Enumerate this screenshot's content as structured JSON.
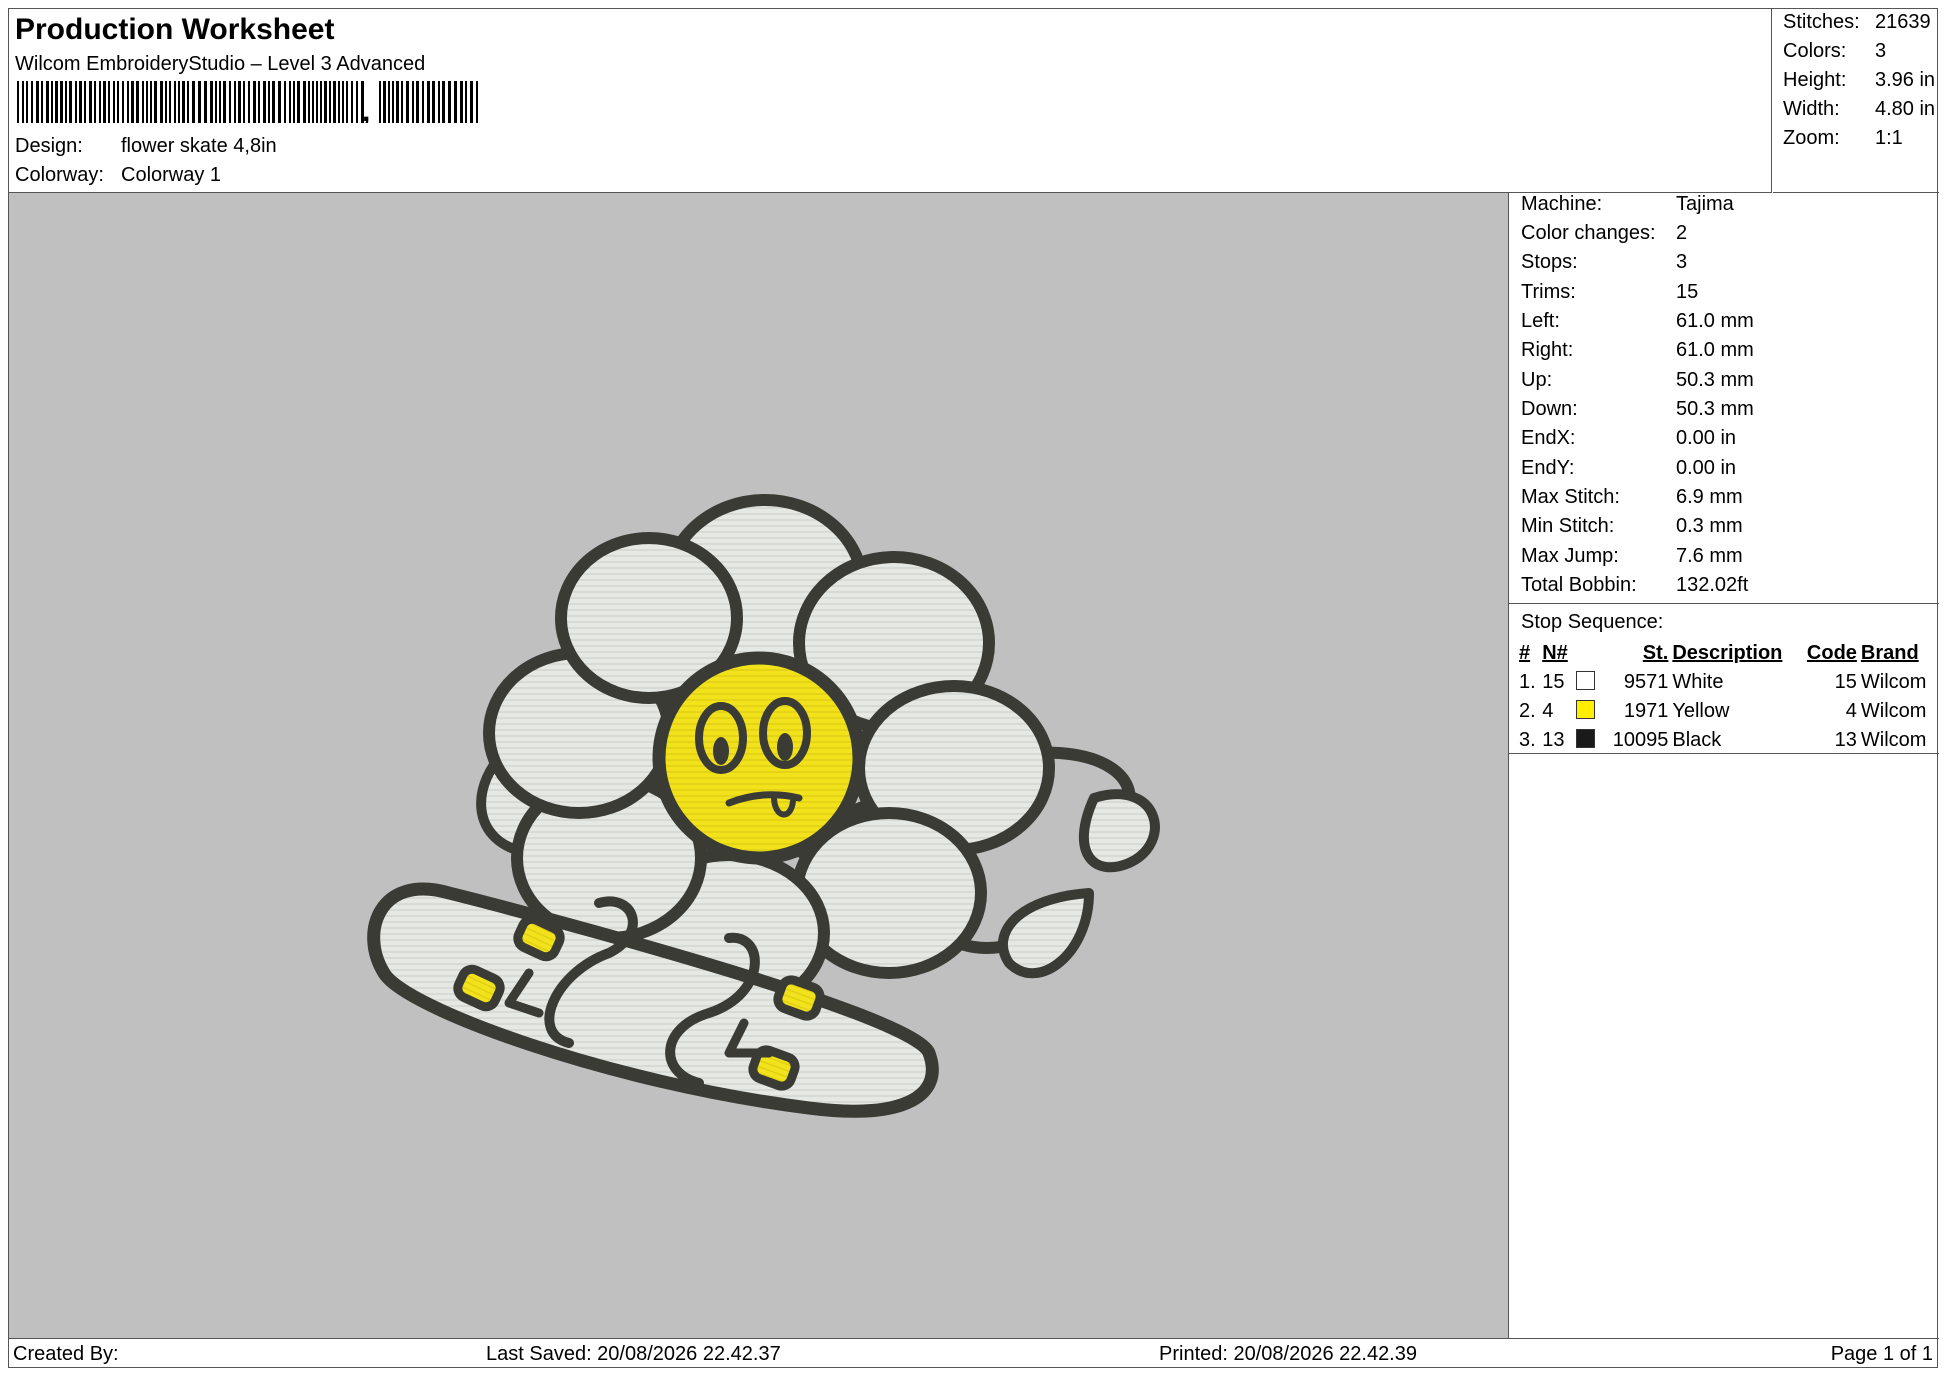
{
  "header": {
    "title": "Production Worksheet",
    "software": "Wilcom EmbroideryStudio – Level 3 Advanced",
    "design_label": "Design:",
    "design_value": "flower skate 4,8in",
    "colorway_label": "Colorway:",
    "colorway_value": "Colorway 1"
  },
  "summary": [
    {
      "label": "Stitches:",
      "value": "21639"
    },
    {
      "label": "Colors:",
      "value": "3"
    },
    {
      "label": "Height:",
      "value": "3.96 in"
    },
    {
      "label": "Width:",
      "value": "4.80 in"
    },
    {
      "label": "Zoom:",
      "value": "1:1"
    }
  ],
  "machine_info": [
    {
      "label": "Machine:",
      "value": "Tajima"
    },
    {
      "label": "Color changes:",
      "value": "2"
    },
    {
      "label": "Stops:",
      "value": "3"
    },
    {
      "label": "Trims:",
      "value": "15"
    },
    {
      "label": "Left:",
      "value": "61.0 mm"
    },
    {
      "label": "Right:",
      "value": "61.0 mm"
    },
    {
      "label": "Up:",
      "value": "50.3 mm"
    },
    {
      "label": "Down:",
      "value": "50.3 mm"
    },
    {
      "label": "EndX:",
      "value": "0.00 in"
    },
    {
      "label": "EndY:",
      "value": "0.00 in"
    },
    {
      "label": "Max Stitch:",
      "value": "6.9 mm"
    },
    {
      "label": "Min Stitch:",
      "value": "0.3 mm"
    },
    {
      "label": "Max Jump:",
      "value": "7.6 mm"
    },
    {
      "label": "Total Bobbin:",
      "value": "132.02ft"
    }
  ],
  "stop_sequence": {
    "title": "Stop Sequence:",
    "columns": [
      "#",
      "N#",
      "St.",
      "Description",
      "Code",
      "Brand"
    ],
    "rows": [
      {
        "index": "1.",
        "needle": "15",
        "color": "#ffffff",
        "stitches": "9571",
        "description": "White",
        "code": "15",
        "brand": "Wilcom"
      },
      {
        "index": "2.",
        "needle": "4",
        "color": "#ffee00",
        "stitches": "1971",
        "description": "Yellow",
        "code": "4",
        "brand": "Wilcom"
      },
      {
        "index": "3.",
        "needle": "13",
        "color": "#1a1a1a",
        "stitches": "10095",
        "description": "Black",
        "code": "13",
        "brand": "Wilcom"
      }
    ]
  },
  "footer": {
    "created_by": "Created By:",
    "last_saved": "Last Saved: 20/08/2026 22.42.37",
    "printed": "Printed: 20/08/2026 22.42.39",
    "page": "Page 1 of 1"
  },
  "colors": {
    "canvas_bg": "#c0c0c0",
    "outline": "#3a3b35",
    "fill_white": "#e6e8e4",
    "fill_yellow": "#f2e21c"
  }
}
